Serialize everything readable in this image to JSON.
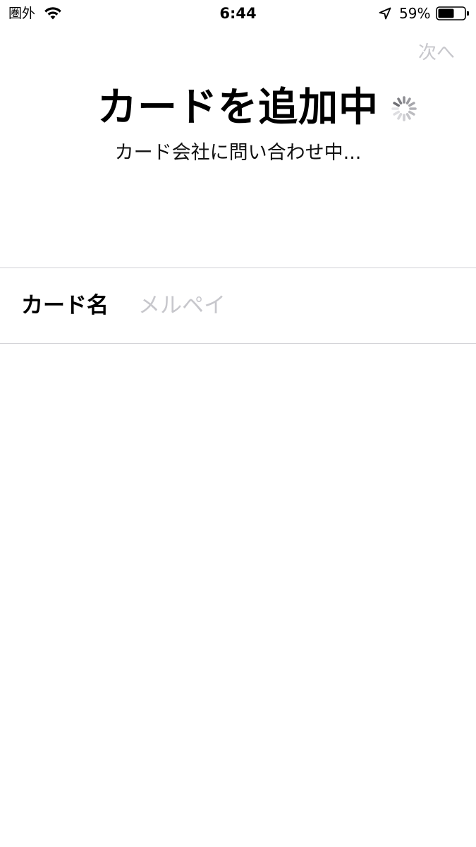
{
  "status_bar": {
    "carrier": "圏外",
    "time": "6:44",
    "battery": "59%",
    "icons": [
      "wifi-icon",
      "location-arrow-icon",
      "battery-icon"
    ]
  },
  "nav": {
    "next_label": "次へ"
  },
  "header": {
    "title": "カードを追加中",
    "subtitle": "カード会社に問い合わせ中...",
    "spinner_icon": "activity-spinner-icon"
  },
  "card_name_field": {
    "label": "カード名",
    "value": "",
    "placeholder": "メルペイ"
  },
  "colors": {
    "disabled_text": "#c7c7cc",
    "separator": "#d1d1d6",
    "text": "#000000",
    "background": "#ffffff"
  }
}
